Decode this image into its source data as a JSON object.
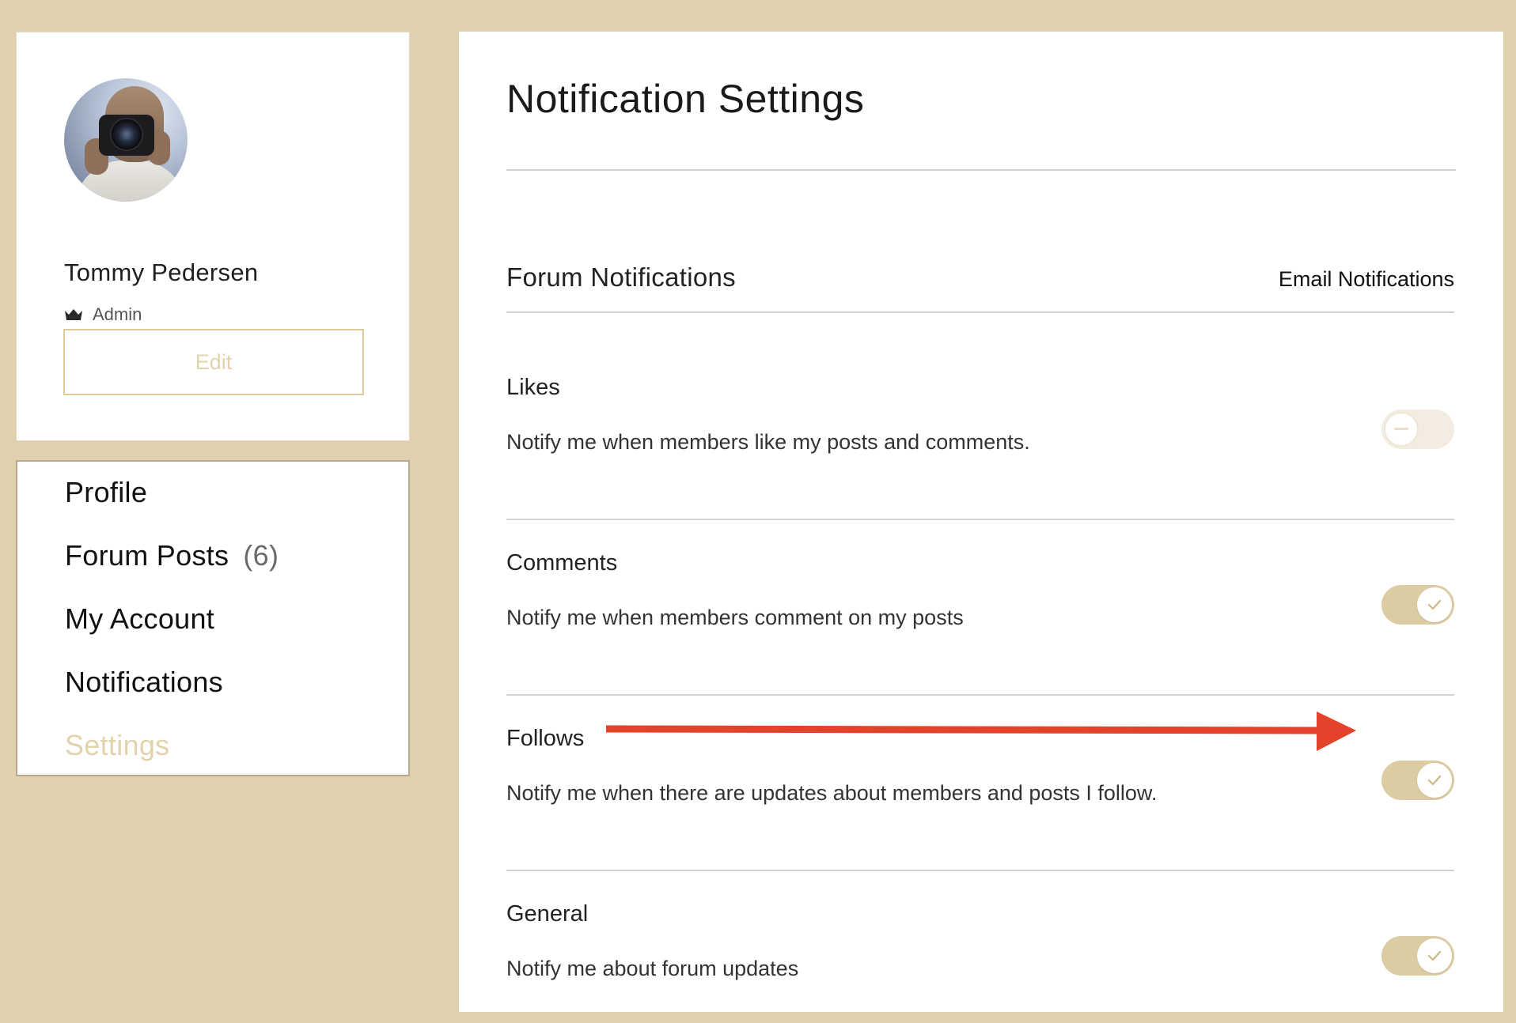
{
  "colors": {
    "page_background": "#dfd0ae",
    "accent": "#dccca4",
    "accent_text": "#e2d3ad",
    "annotation_arrow": "#e2432a"
  },
  "profile": {
    "name": "Tommy Pedersen",
    "role": "Admin",
    "role_icon": "crown-icon",
    "edit_label": "Edit"
  },
  "nav": {
    "items": [
      {
        "label": "Profile",
        "active": false
      },
      {
        "label": "Forum Posts",
        "count": "(6)",
        "active": false
      },
      {
        "label": "My Account",
        "active": false
      },
      {
        "label": "Notifications",
        "active": false
      },
      {
        "label": "Settings",
        "active": true
      }
    ]
  },
  "main": {
    "title": "Notification Settings",
    "section_title": "Forum Notifications",
    "email_column_label": "Email Notifications",
    "settings": [
      {
        "title": "Likes",
        "description": "Notify me when members like my posts and comments.",
        "enabled": false
      },
      {
        "title": "Comments",
        "description": "Notify me when members comment on my posts",
        "enabled": true
      },
      {
        "title": "Follows",
        "description": "Notify me when there are updates about members and posts I follow.",
        "enabled": true
      },
      {
        "title": "General",
        "description": "Notify me about forum updates",
        "enabled": true
      }
    ]
  },
  "annotation": {
    "icon": "arrow-right-icon",
    "points_to": "Follows email notification toggle"
  }
}
